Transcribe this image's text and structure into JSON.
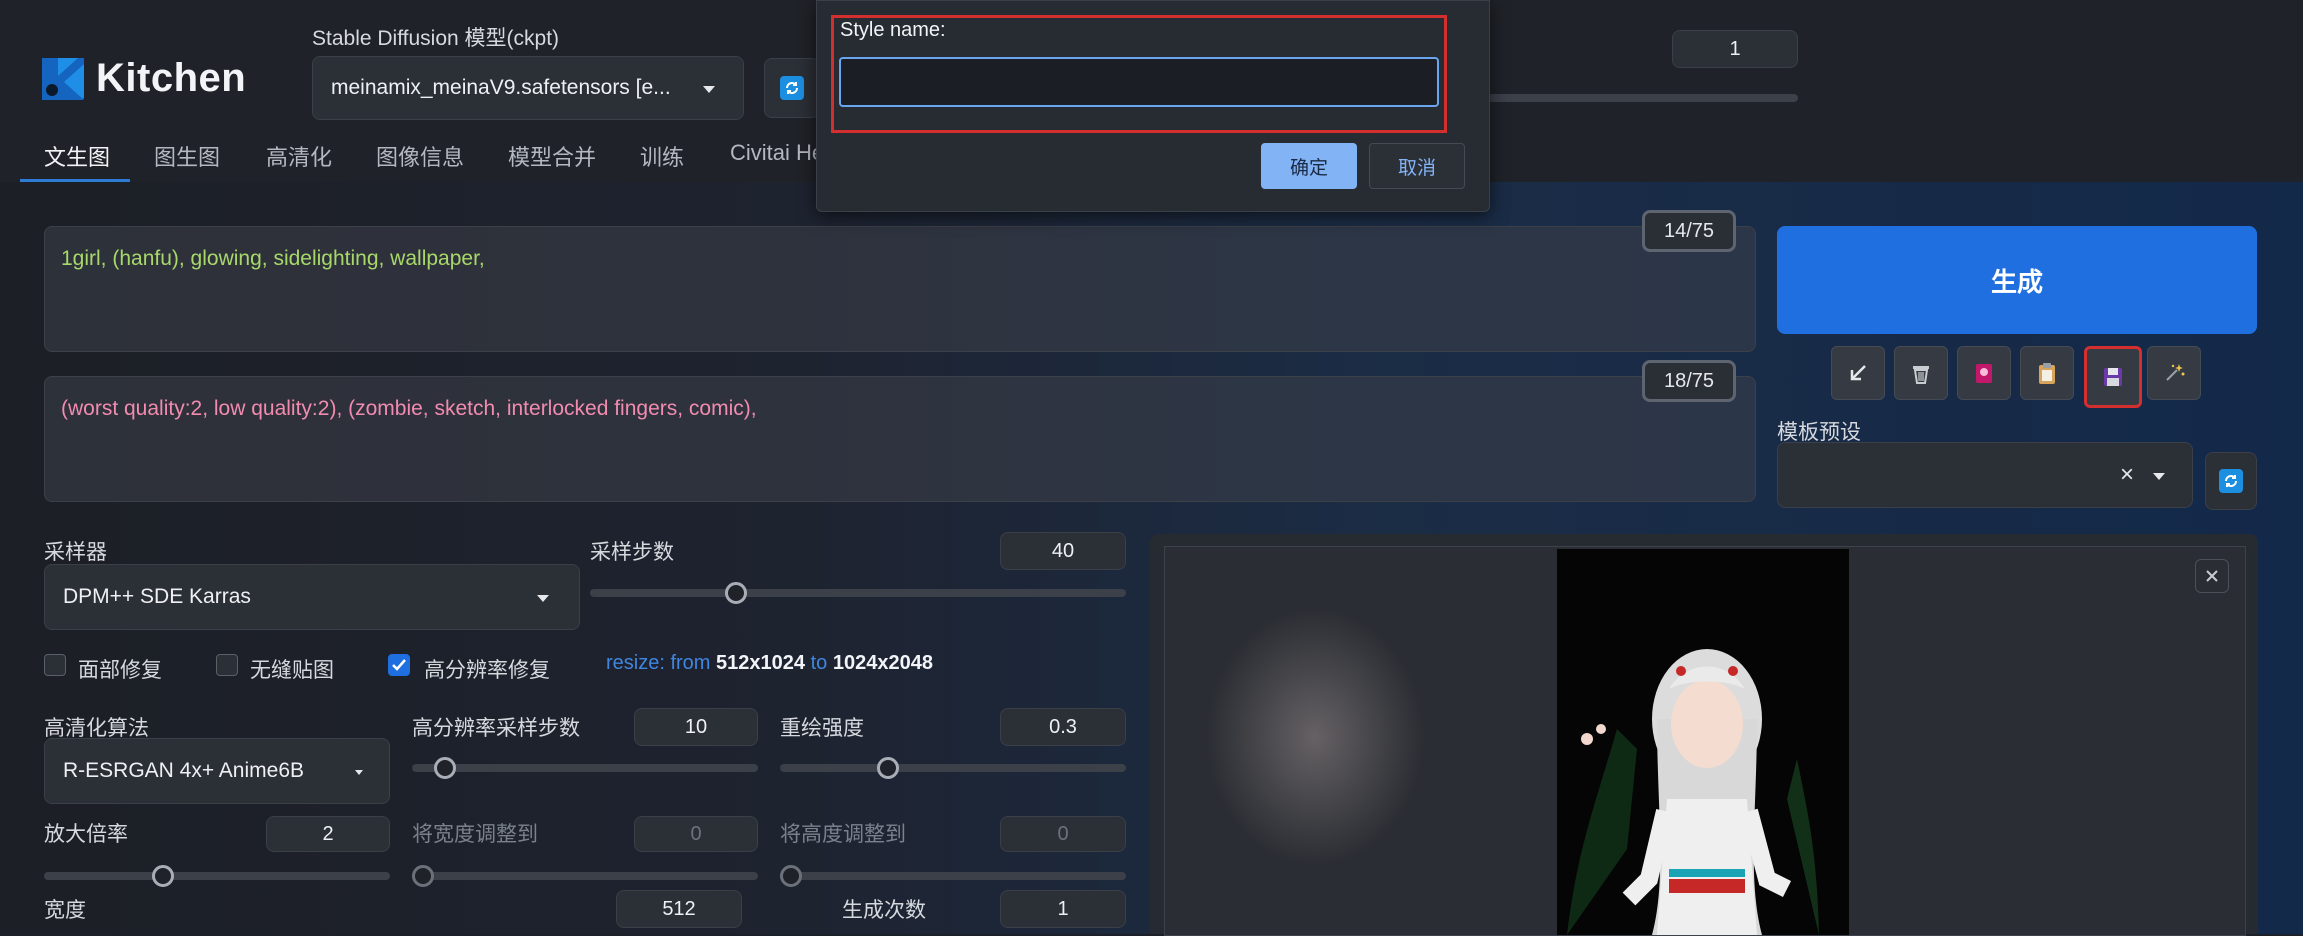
{
  "app": {
    "logo_text": "Kitchen"
  },
  "model": {
    "label": "Stable Diffusion 模型(ckpt)",
    "value": "meinamix_meinaV9.safetensors [e..."
  },
  "top_right": {
    "batch_value": "1"
  },
  "tabs": [
    {
      "label": "文生图"
    },
    {
      "label": "图生图"
    },
    {
      "label": "高清化"
    },
    {
      "label": "图像信息"
    },
    {
      "label": "模型合并"
    },
    {
      "label": "训练"
    },
    {
      "label": "Civitai He"
    }
  ],
  "prompt": {
    "text": "1girl, (hanfu), glowing, sidelighting, wallpaper,",
    "counter": "14/75",
    "color": "#a8d86a"
  },
  "negative_prompt": {
    "text": "(worst quality:2, low quality:2), (zombie, sketch, interlocked fingers, comic),",
    "counter": "18/75",
    "color": "#f28bb0"
  },
  "generate": {
    "label": "生成"
  },
  "toolbar": {
    "icons": [
      "arrow-down-left-icon",
      "trash-icon",
      "pink-card-icon",
      "clipboard-icon",
      "save-icon",
      "sparkle-icon"
    ]
  },
  "style_preset": {
    "label": "模板预设",
    "clear": "×"
  },
  "sampler": {
    "label": "采样器",
    "value": "DPM++ SDE Karras"
  },
  "steps": {
    "label": "采样步数",
    "value": "40",
    "min": 1,
    "max": 150
  },
  "checks": {
    "face_restore": {
      "label": "面部修复",
      "checked": false
    },
    "tiling": {
      "label": "无缝贴图",
      "checked": false
    },
    "hires_fix": {
      "label": "高分辨率修复",
      "checked": true
    }
  },
  "resize_info": {
    "prefix": "resize: from",
    "from": "512x1024",
    "to_word": "to",
    "to": "1024x2048"
  },
  "upscaler": {
    "label": "高清化算法",
    "value": "R-ESRGAN 4x+ Anime6B"
  },
  "hires_steps": {
    "label": "高分辨率采样步数",
    "value": "10",
    "min": 0,
    "max": 150
  },
  "denoise": {
    "label": "重绘强度",
    "value": "0.3",
    "min": 0,
    "max": 1
  },
  "upscale_by": {
    "label": "放大倍率",
    "value": "2",
    "min": 1,
    "max": 4
  },
  "resize_width": {
    "label": "将宽度调整到",
    "value": "0"
  },
  "resize_height": {
    "label": "将高度调整到",
    "value": "0"
  },
  "width": {
    "label": "宽度",
    "value": "512"
  },
  "batch_count": {
    "label": "生成次数",
    "value": "1"
  },
  "modal": {
    "label": "Style name:",
    "input_value": "",
    "ok": "确定",
    "cancel": "取消"
  },
  "colors": {
    "accent": "#1f6fe0",
    "highlight": "#d32f2f",
    "link": "#3f86e0"
  }
}
